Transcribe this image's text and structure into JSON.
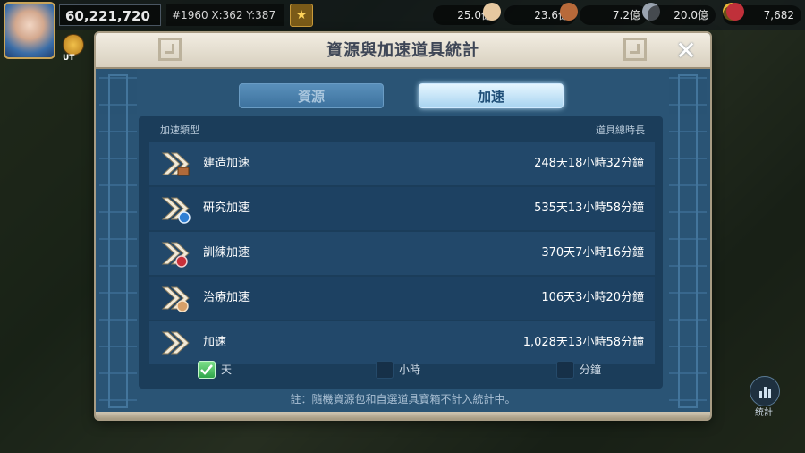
{
  "hud": {
    "power": "60,221,720",
    "coords": "#1960 X:362 Y:387",
    "alliance_tag": "UT",
    "resources": [
      {
        "name": "food",
        "value": "25.0億",
        "color": "#e6c8a0"
      },
      {
        "name": "wood",
        "value": "23.6億",
        "color": "#b86a3a"
      },
      {
        "name": "stone",
        "value": "7.2億",
        "color": "#9aa4b0"
      },
      {
        "name": "gold",
        "value": "20.0億",
        "color": "#e8b838"
      },
      {
        "name": "gems",
        "value": "7,682",
        "color": "#c0303a"
      }
    ]
  },
  "modal": {
    "title": "資源與加速道具統計",
    "tabs": [
      {
        "label": "資源",
        "active": false
      },
      {
        "label": "加速",
        "active": true
      }
    ],
    "col_type": "加速類型",
    "col_total": "道具總時長",
    "rows": [
      {
        "label": "建造加速",
        "value": "248天18小時32分鐘",
        "icon": "build-speedup-icon"
      },
      {
        "label": "研究加速",
        "value": "535天13小時58分鐘",
        "icon": "research-speedup-icon"
      },
      {
        "label": "訓練加速",
        "value": "370天7小時16分鐘",
        "icon": "training-speedup-icon"
      },
      {
        "label": "治療加速",
        "value": "106天3小時20分鐘",
        "icon": "healing-speedup-icon"
      },
      {
        "label": "加速",
        "value": "1,028天13小時58分鐘",
        "icon": "universal-speedup-icon"
      }
    ],
    "units": [
      {
        "label": "天",
        "checked": true
      },
      {
        "label": "小時",
        "checked": false
      },
      {
        "label": "分鐘",
        "checked": false
      }
    ],
    "footnote": "註：隨機資源包和自選道具寶箱不計入統計中。"
  },
  "side": {
    "stats_label": "統計"
  }
}
